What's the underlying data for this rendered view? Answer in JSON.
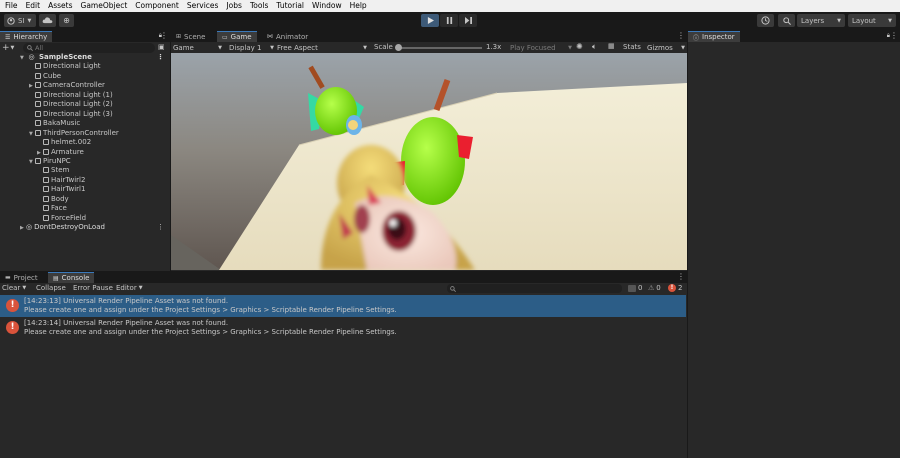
{
  "menu": [
    "File",
    "Edit",
    "Assets",
    "GameObject",
    "Component",
    "Services",
    "Jobs",
    "Tools",
    "Tutorial",
    "Window",
    "Help"
  ],
  "toolbar": {
    "account": "SI",
    "layers_label": "Layers",
    "layout_label": "Layout"
  },
  "hierarchy": {
    "tab_label": "Hierarchy",
    "search_placeholder": "All",
    "scene": "SampleScene",
    "items": [
      {
        "label": "Directional Light",
        "depth": 1,
        "arrow": false
      },
      {
        "label": "Cube",
        "depth": 1,
        "arrow": false
      },
      {
        "label": "CameraController",
        "depth": 1,
        "arrow": true
      },
      {
        "label": "Directional Light (1)",
        "depth": 1,
        "arrow": false
      },
      {
        "label": "Directional Light (2)",
        "depth": 1,
        "arrow": false
      },
      {
        "label": "Directional Light (3)",
        "depth": 1,
        "arrow": false
      },
      {
        "label": "BakaMusic",
        "depth": 1,
        "arrow": false
      },
      {
        "label": "ThirdPersonController",
        "depth": 1,
        "arrow": "open"
      },
      {
        "label": "helmet.002",
        "depth": 2,
        "arrow": false
      },
      {
        "label": "Armature",
        "depth": 2,
        "arrow": true
      },
      {
        "label": "PiruNPC",
        "depth": 1,
        "arrow": "open"
      },
      {
        "label": "Stem",
        "depth": 2,
        "arrow": false
      },
      {
        "label": "HairTwirl2",
        "depth": 2,
        "arrow": false
      },
      {
        "label": "HairTwirl1",
        "depth": 2,
        "arrow": false
      },
      {
        "label": "Body",
        "depth": 2,
        "arrow": false
      },
      {
        "label": "Face",
        "depth": 2,
        "arrow": false
      },
      {
        "label": "ForceField",
        "depth": 2,
        "arrow": false
      }
    ],
    "dont_destroy": "DontDestroyOnLoad"
  },
  "center_tabs": [
    "Scene",
    "Game",
    "Animator"
  ],
  "game_bar": {
    "mode": "Game",
    "display": "Display 1",
    "aspect": "Free Aspect",
    "scale_label": "Scale",
    "scale_value": "1.3x",
    "play_focused": "Play Focused",
    "stats": "Stats",
    "gizmos": "Gizmos"
  },
  "bottom_tabs": [
    "Project",
    "Console"
  ],
  "console_bar": {
    "clear": "Clear",
    "collapse": "Collapse",
    "error_pause": "Error Pause",
    "editor": "Editor",
    "log_count": "0",
    "warn_count": "0",
    "error_count": "2"
  },
  "logs": [
    {
      "line1": "[14:23:13] Universal Render Pipeline Asset was not found.",
      "line2": "Please create one and assign under the Project Settings > Graphics > Scriptable Render Pipeline Settings.",
      "selected": true
    },
    {
      "line1": "[14:23:14] Universal Render Pipeline Asset was not found.",
      "line2": "Please create one and assign under the Project Settings > Graphics > Scriptable Render Pipeline Settings.",
      "selected": false
    }
  ],
  "inspector": {
    "tab_label": "Inspector"
  },
  "colors": {
    "accent": "#3a79bb",
    "selection": "#2c5d87",
    "error": "#d9533b"
  }
}
